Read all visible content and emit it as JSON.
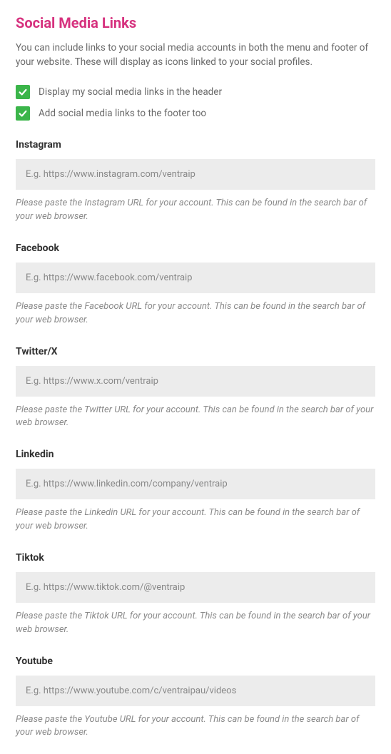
{
  "title": "Social Media Links",
  "description": "You can include links to your social media accounts in both the menu and footer of your website. These will display as icons linked to your social profiles.",
  "checkboxes": [
    {
      "label": "Display my social media links in the header",
      "checked": true
    },
    {
      "label": "Add social media links to the footer too",
      "checked": true
    }
  ],
  "fields": [
    {
      "label": "Instagram",
      "placeholder": "E.g. https://www.instagram.com/ventraip",
      "help": "Please paste the Instagram URL for your account. This can be found in the search bar of your web browser."
    },
    {
      "label": "Facebook",
      "placeholder": "E.g. https://www.facebook.com/ventraip",
      "help": "Please paste the Facebook URL for your account. This can be found in the search bar of your web browser."
    },
    {
      "label": "Twitter/X",
      "placeholder": "E.g. https://www.x.com/ventraip",
      "help": "Please paste the Twitter URL for your account. This can be found in the search bar of your web browser."
    },
    {
      "label": "Linkedin",
      "placeholder": "E.g. https://www.linkedin.com/company/ventraip",
      "help": "Please paste the Linkedin URL for your account. This can be found in the search bar of your web browser."
    },
    {
      "label": "Tiktok",
      "placeholder": "E.g. https://www.tiktok.com/@ventraip",
      "help": "Please paste the Tiktok URL for your account. This can be found in the search bar of your web browser."
    },
    {
      "label": "Youtube",
      "placeholder": "E.g. https://www.youtube.com/c/ventraipau/videos",
      "help": "Please paste the Youtube URL for your account. This can be found in the search bar of your web browser."
    }
  ]
}
